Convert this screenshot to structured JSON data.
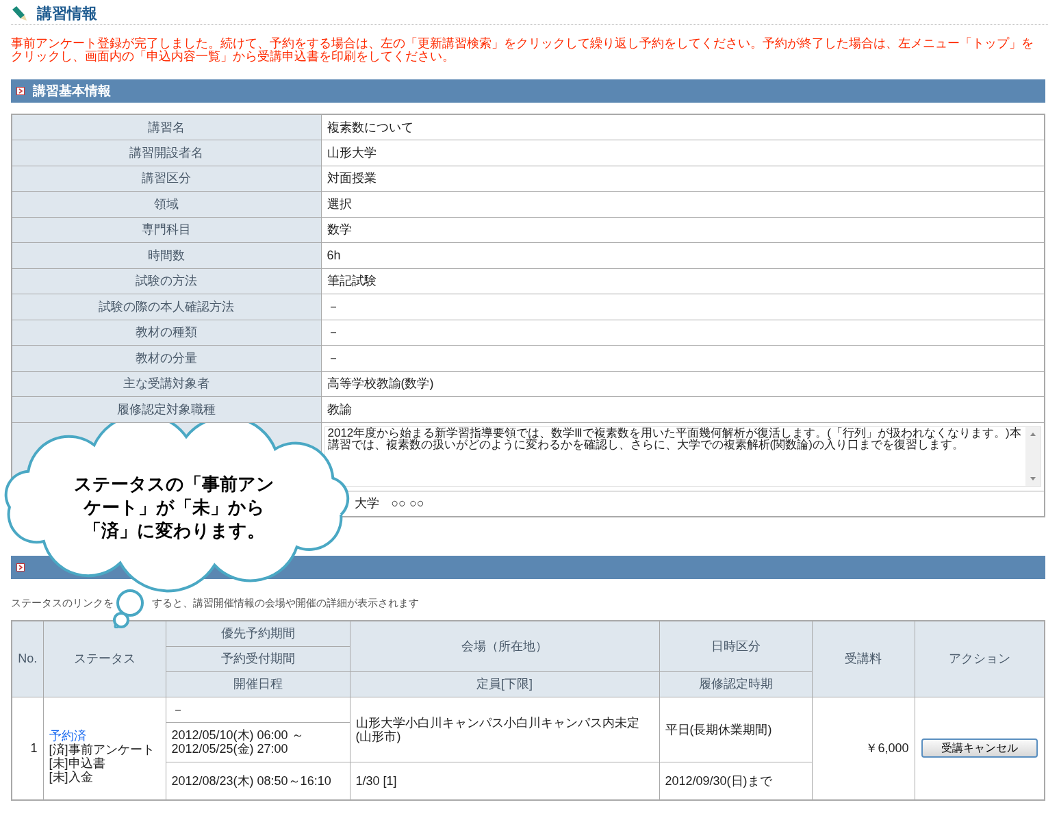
{
  "page_title": "講習情報",
  "notice": "事前アンケート登録が完了しました。続けて、予約をする場合は、左の「更新講習検索」をクリックして繰り返し予約をしてください。予約が終了した場合は、左メニュー「トップ」をクリックし、画面内の「申込内容一覧」から受講申込書を印刷をしてください。",
  "basic_info": {
    "title": "講習基本情報",
    "rows": [
      {
        "kind": "text",
        "label": "講習名",
        "value": "複素数について"
      },
      {
        "kind": "text",
        "label": "講習開設者名",
        "value": "山形大学"
      },
      {
        "kind": "text",
        "label": "講習区分",
        "value": "対面授業"
      },
      {
        "kind": "text",
        "label": "領域",
        "value": "選択"
      },
      {
        "kind": "text",
        "label": "専門科目",
        "value": "数学"
      },
      {
        "kind": "text",
        "label": "時間数",
        "value": "6h"
      },
      {
        "kind": "text",
        "label": "試験の方法",
        "value": "筆記試験"
      },
      {
        "kind": "text",
        "label": "試験の際の本人確認方法",
        "value": "－"
      },
      {
        "kind": "text",
        "label": "教材の種類",
        "value": "－"
      },
      {
        "kind": "text",
        "label": "教材の分量",
        "value": "－"
      },
      {
        "kind": "text",
        "label": "主な受講対象者",
        "value": "高等学校教諭(数学)"
      },
      {
        "kind": "text",
        "label": "履修認定対象職種",
        "value": "教諭"
      },
      {
        "kind": "textarea",
        "value": "2012年度から始まる新学習指導要領では、数学Ⅲで複素数を用いた平面幾何解析が復活します。(「行列」が扱われなくなります。)本講習では、複素数の扱いがどのように変わるかを確認し、さらに、大学での複素解析(関数論)の入り口までを復習します。"
      },
      {
        "kind": "covered",
        "value": "大学　○○ ○○"
      }
    ]
  },
  "sessions": {
    "hint_before": "ステータスのリンクを",
    "hint_after": "すると、講習開催情報の会場や開催の詳細が表示されます",
    "headers": {
      "no": "No.",
      "status": "ステータス",
      "priority_period": "優先予約期間",
      "booking_period": "予約受付期間",
      "dates": "開催日程",
      "venue": "会場（所在地）",
      "capacity": "定員[下限]",
      "time_category": "日時区分",
      "certification": "履修認定時期",
      "fee": "受講料",
      "action": "アクション"
    },
    "rows": [
      {
        "no": "1",
        "status_link": "予約済",
        "status_items": [
          "[済]事前アンケート",
          "[未]申込書",
          "[未]入金"
        ],
        "priority_period": "－",
        "booking_period": "2012/05/10(木) 06:00 ～ 2012/05/25(金) 27:00",
        "dates": "2012/08/23(木) 08:50～16:10",
        "venue": "山形大学小白川キャンパス小白川キャンパス内未定(山形市)",
        "capacity": "1/30 [1]",
        "time_category": "平日(長期休業期間)",
        "certification": "2012/09/30(日)まで",
        "fee": "￥6,000",
        "action": "受講キャンセル"
      }
    ]
  },
  "callout": {
    "text": "ステータスの「事前アンケート」が「未」から「済」に変わります。"
  }
}
